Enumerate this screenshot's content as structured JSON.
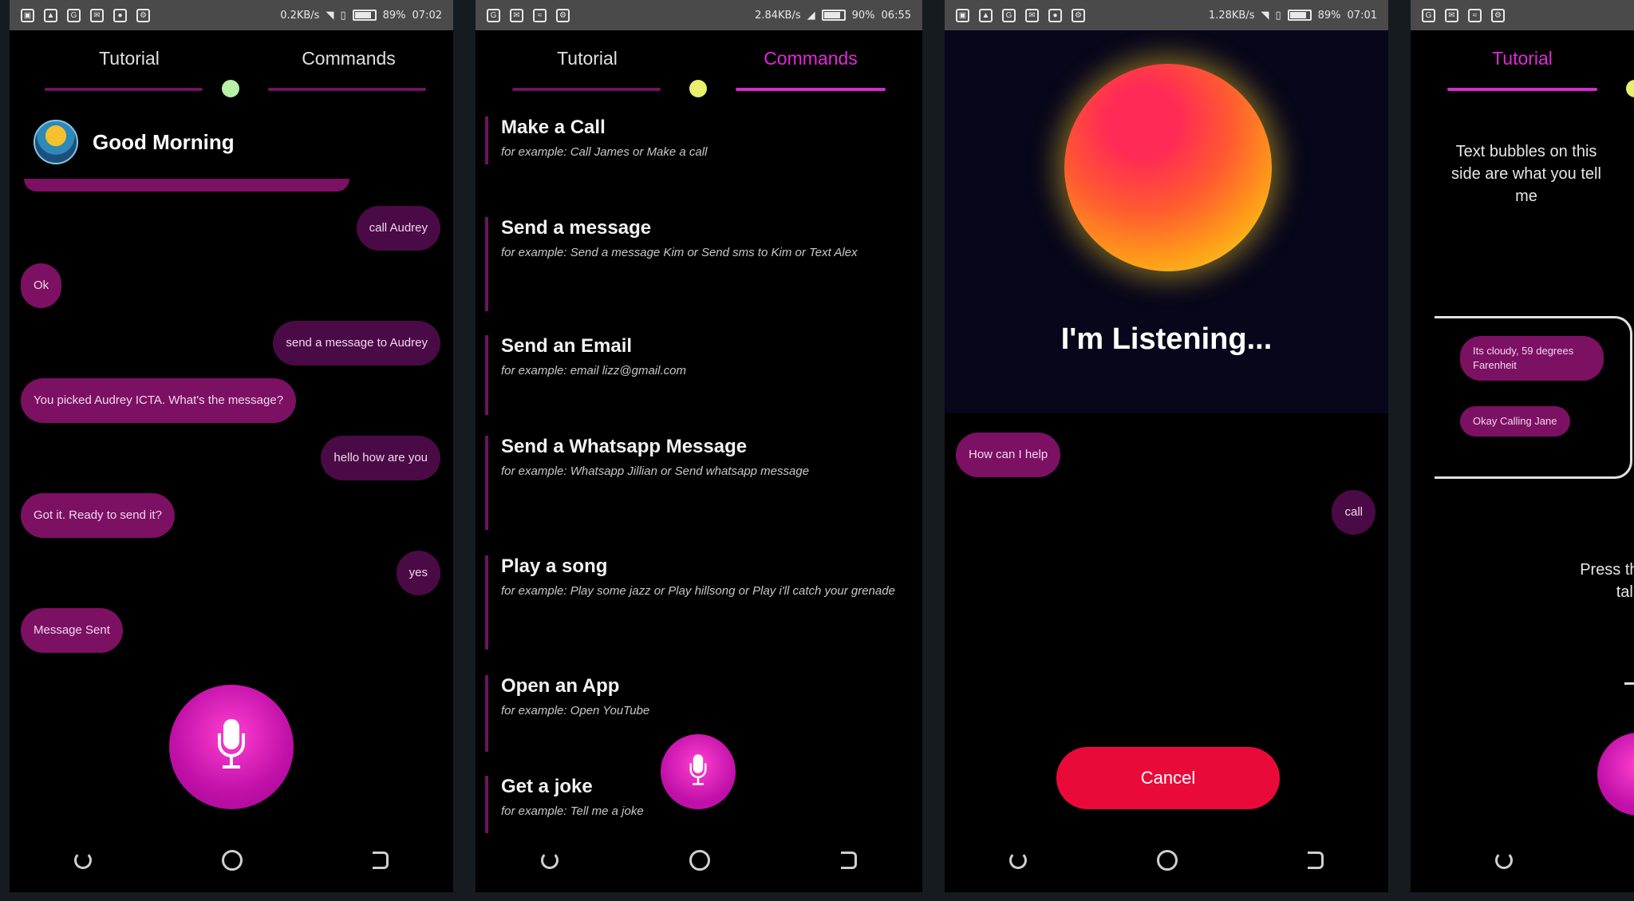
{
  "status_bars": [
    {
      "speed": "0.2KB/s",
      "battery": "89%",
      "time": "07:02"
    },
    {
      "speed": "2.84KB/s",
      "battery": "90%",
      "time": "06:55"
    },
    {
      "speed": "1.28KB/s",
      "battery": "89%",
      "time": "07:01"
    },
    {
      "speed": "",
      "battery": "",
      "time": ""
    }
  ],
  "tabs": {
    "tutorial": "Tutorial",
    "commands": "Commands"
  },
  "chat": {
    "greeting": "Good Morning",
    "messages": [
      {
        "from": "user",
        "text": "call Audrey"
      },
      {
        "from": "bot",
        "text": "Ok"
      },
      {
        "from": "user",
        "text": "send a message to Audrey"
      },
      {
        "from": "bot",
        "text": "You picked Audrey ICTA. What's the message?"
      },
      {
        "from": "user",
        "text": "hello how are you"
      },
      {
        "from": "bot",
        "text": "Got it. Ready to send it?"
      },
      {
        "from": "user",
        "text": "yes"
      },
      {
        "from": "bot",
        "text": "Message Sent"
      }
    ]
  },
  "commands": [
    {
      "title": "Make a Call",
      "example": "for example: Call James or Make a call"
    },
    {
      "title": "Send a message",
      "example": "for example: Send a message Kim or Send sms to Kim or Text Alex"
    },
    {
      "title": "Send an Email",
      "example": "for example: email lizz@gmail.com"
    },
    {
      "title": "Send a Whatsapp Message",
      "example": "for example: Whatsapp Jillian or Send whatsapp message"
    },
    {
      "title": "Play a song",
      "example": "for example: Play some jazz or Play hillsong or Play i'll catch your grenade"
    },
    {
      "title": "Open an App",
      "example": "for example: Open YouTube"
    },
    {
      "title": "Get a joke",
      "example": "for example: Tell me a joke"
    }
  ],
  "listening": {
    "title": "I'm Listening...",
    "bot_message": "How can I help",
    "user_message": "call",
    "cancel_label": "Cancel"
  },
  "tutorial": {
    "bubbles_note": "Text bubbles on this side are what you tell me",
    "sample_1": "Its cloudy, 59 degrees Farenheit",
    "sample_2": "Okay Calling Jane",
    "press_note": "Press this\ntalk t"
  },
  "icons": {
    "mic": "microphone-icon",
    "back": "back-icon",
    "home": "home-icon",
    "recent": "recent-apps-icon"
  },
  "colors": {
    "accent": "#d42bcf",
    "bot_bubble": "#7c1063",
    "user_bubble": "#4a0a45",
    "cancel": "#ea0a3a",
    "dot_green": "#b8f0a8",
    "dot_yellow": "#e8f070"
  }
}
